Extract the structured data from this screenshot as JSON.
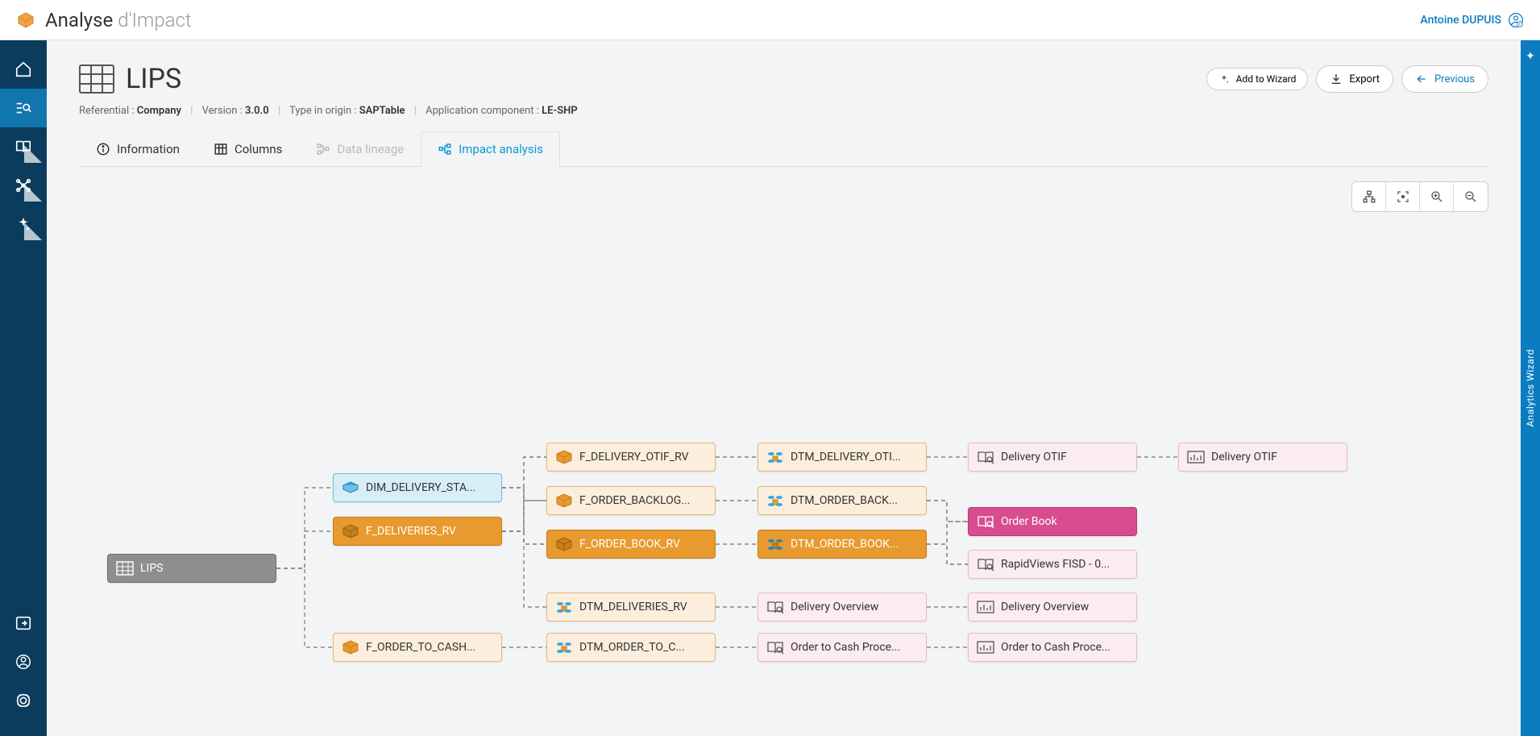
{
  "header": {
    "title_main": "Analyse",
    "title_sub": "d'Impact",
    "user": "Antoine DUPUIS"
  },
  "right_rail": {
    "label": "Analytics Wizard"
  },
  "page": {
    "title": "LIPS",
    "btn_wizard": "Add to Wizard",
    "btn_export": "Export",
    "btn_previous": "Previous"
  },
  "meta": {
    "referential_label": "Referential :",
    "referential_value": "Company",
    "version_label": "Version :",
    "version_value": "3.0.0",
    "type_label": "Type in origin :",
    "type_value": "SAPTable",
    "appcomp_label": "Application component :",
    "appcomp_value": "LE-SHP"
  },
  "tabs": {
    "info": "Information",
    "columns": "Columns",
    "lineage": "Data lineage",
    "impact": "Impact analysis"
  },
  "nodes": {
    "root": "LIPS",
    "dim_delivery": "DIM_DELIVERY_STA...",
    "f_deliveries": "F_DELIVERIES_RV",
    "f_order_to_cash": "F_ORDER_TO_CASH...",
    "f_delivery_otif": "F_DELIVERY_OTIF_RV",
    "f_order_backlog": "F_ORDER_BACKLOG...",
    "f_order_book": "F_ORDER_BOOK_RV",
    "dtm_deliveries": "DTM_DELIVERIES_RV",
    "dtm_order_to_c": "DTM_ORDER_TO_C...",
    "dtm_delivery_otif": "DTM_DELIVERY_OTI...",
    "dtm_order_back": "DTM_ORDER_BACK...",
    "dtm_order_book": "DTM_ORDER_BOOK...",
    "delivery_overview_book": "Delivery Overview",
    "order_to_cash_proc_book": "Order to Cash Proce...",
    "delivery_otif_book": "Delivery OTIF",
    "order_book": "Order Book",
    "rapidviews": "RapidViews FISD - 0...",
    "delivery_overview_chart": "Delivery Overview",
    "order_to_cash_chart": "Order to Cash Proce...",
    "delivery_otif_chart": "Delivery OTIF"
  }
}
